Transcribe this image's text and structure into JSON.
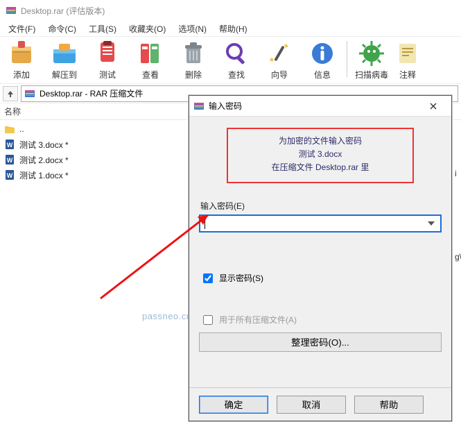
{
  "window": {
    "title": "Desktop.rar (评估版本)"
  },
  "menu": {
    "file": "文件(F)",
    "cmd": "命令(C)",
    "tool": "工具(S)",
    "fav": "收藏夹(O)",
    "opt": "选项(N)",
    "help": "帮助(H)"
  },
  "toolbar": {
    "add": "添加",
    "extract": "解压到",
    "test": "测试",
    "view": "查看",
    "delete": "删除",
    "find": "查找",
    "wizard": "向导",
    "info": "信息",
    "scan": "扫描病毒",
    "comment": "注释"
  },
  "address": {
    "text": "Desktop.rar - RAR 压缩文件"
  },
  "list": {
    "header_name": "名称",
    "rows": [
      {
        "icon": "folder",
        "name": ".."
      },
      {
        "icon": "docx",
        "name": "测试 3.docx *"
      },
      {
        "icon": "docx",
        "name": "测试 2.docx *"
      },
      {
        "icon": "docx",
        "name": "测试 1.docx *"
      }
    ]
  },
  "dialog": {
    "title": "输入密码",
    "msg_line1": "为加密的文件输入密码",
    "msg_line2": "测试 3.docx",
    "msg_line3": "在压缩文件 Desktop.rar 里",
    "field_label": "输入密码(E)",
    "show_pwd": "显示密码(S)",
    "apply_all": "用于所有压缩文件(A)",
    "organize": "整理密码(O)...",
    "ok": "确定",
    "cancel": "取消",
    "help": "帮助"
  },
  "watermark": "passneo.cn",
  "rightcut": {
    "a": "i",
    "b": "g\\"
  }
}
